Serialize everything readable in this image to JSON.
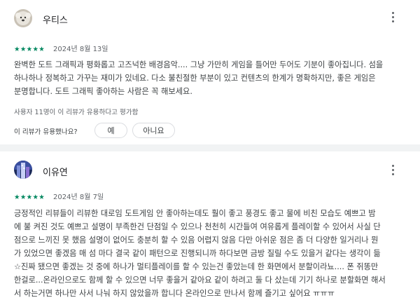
{
  "reviews": [
    {
      "author": "우티스",
      "avatar_icon": "sheepdog-avatar-icon",
      "rating": 5,
      "stars_text": "★★★★★",
      "date": "2024년 8월 13일",
      "body_lines": [
        "완벽한 도트 그래픽과 평화롭고 고즈넉한 배경음악.... 그냥 가만히 게임을 틀어만 두어도 기분이 좋아집니다. 섬을",
        "하나하나 정복하고 가꾸는 재미가 있네요. 다소 불친절한 부분이 있고 컨텐츠의 한계가 명확하지만, 좋은 게임은",
        "분명합니다. 도트 그래픽 좋아하는 사람은 꼭 해보세요."
      ],
      "helpful_count_text": "사용자 11명이 이 리뷰가 유용하다고 평가함",
      "helpful_question": "이 리뷰가 유용했나요?",
      "yes_label": "예",
      "no_label": "아니요"
    },
    {
      "author": "이유연",
      "avatar_icon": "neon-city-avatar-icon",
      "rating": 5,
      "stars_text": "★★★★★",
      "date": "2024년 8월 7일",
      "body_lines": [
        "긍정적인 리뷰들이 리뷰한 대로임 도트게임 안 좋아하는데도 훨이 좋고 풍경도 좋고 물에 비친 모습도 예쁘고 밤",
        "에 불 켜진 것도 예쁘고 설명이 부족한건 단점일 수 있으나 천천히 시간들여 여유롭게 플레이할 수 있어서 사실 단",
        "점으로 느끼진 못 했음 설명이 없어도 충분히 할 수 있음 어렵지 않음 다만 아쉬운 점은 좀 더 다양한 일거리나 뭔",
        "가 있었으면 좋겠음 매 섬 마다 결국 같이 패턴으로 진행되니까 하다보면 금방 질릴 수도 있을거 같다는 생각이 듦",
        "☆진짜 됐으면 좋겠는 것 중에 하나가 멀티플레이를 할 수 있는건 좋았는데 한 화면에서 분할이라뇨.... 폰 쥐똥만",
        "한걸로...온라인으로도 함께 할 수 있으면 너무 좋을거 같아요 같이 하려고 둘 다 샀는데 기기 하나로 분할화면 해서",
        "서 하는거면 하나만 사서 나눠 하지 않았을까 합니다 온라인으로 만나서 함께 즐기고 싶어요 ㅠㅠㅠ"
      ]
    }
  ]
}
